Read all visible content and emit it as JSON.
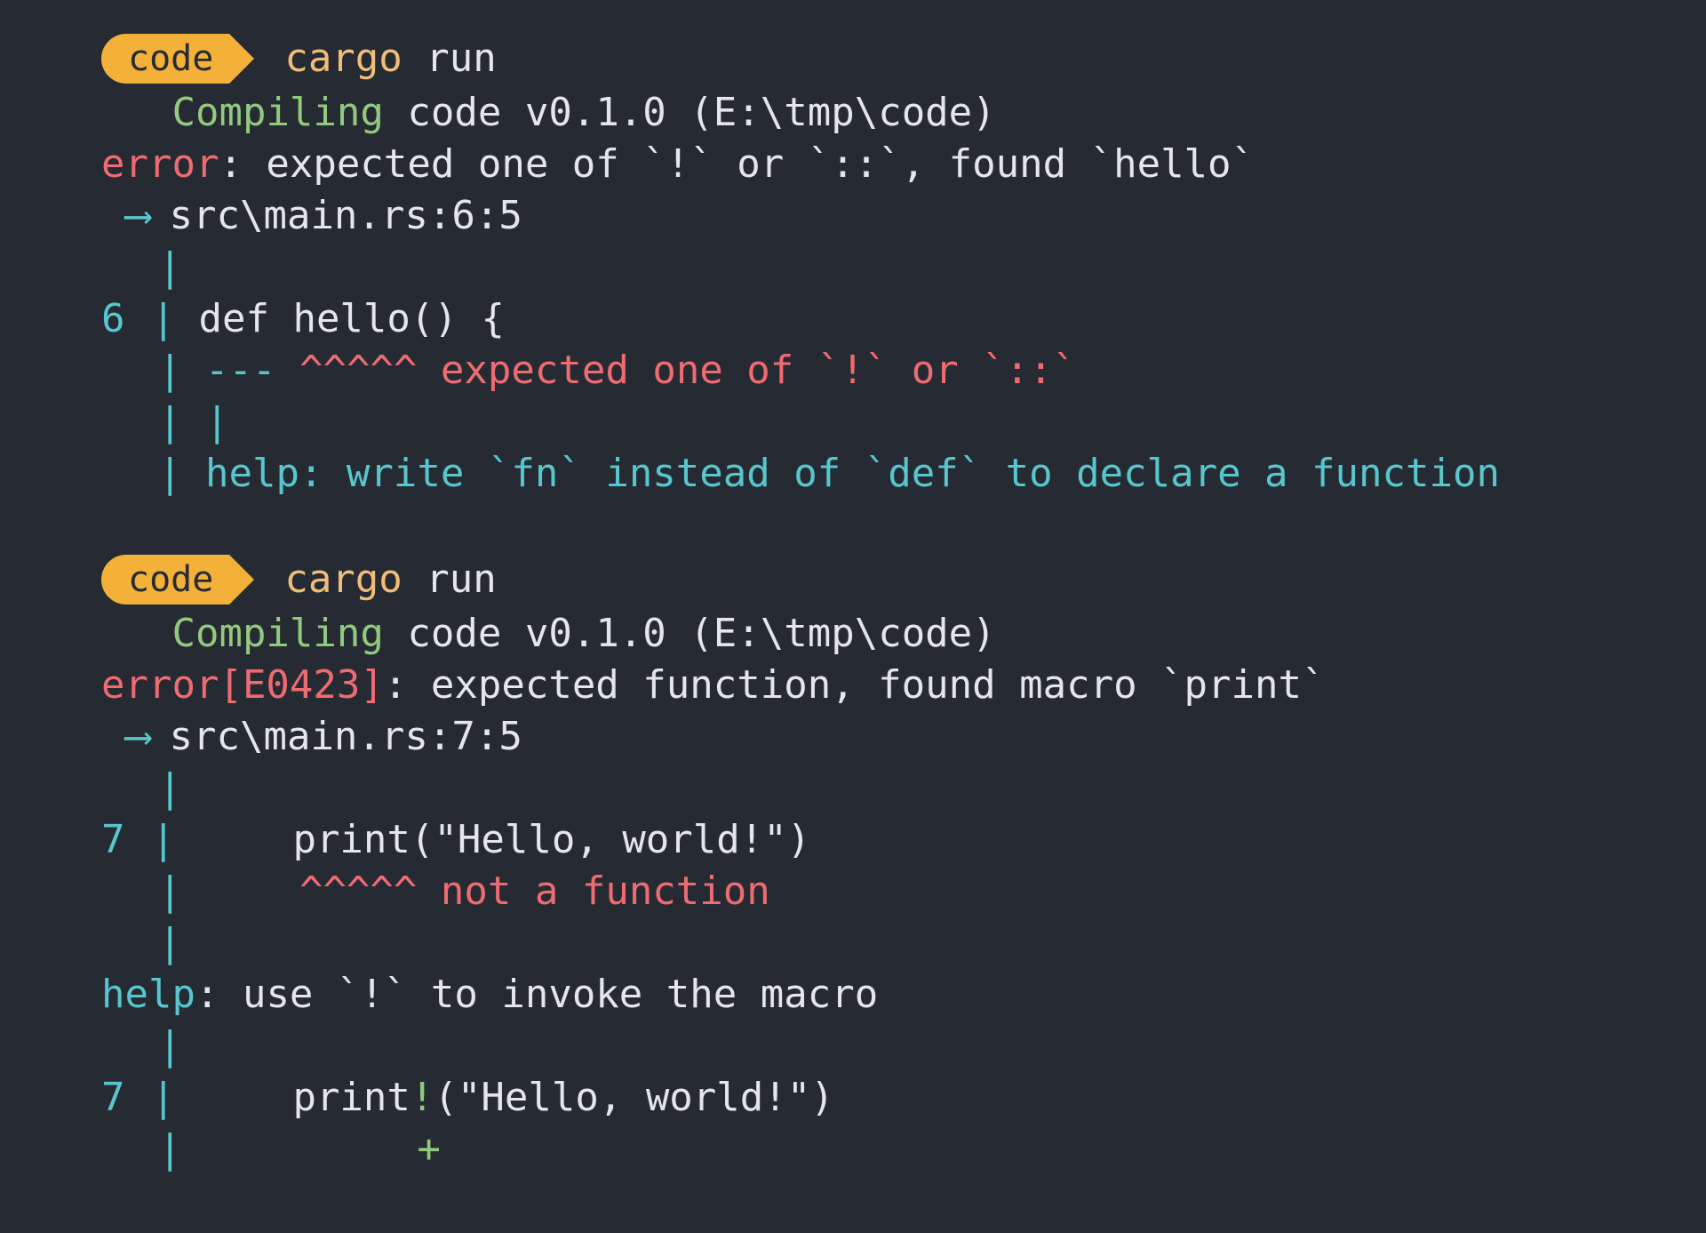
{
  "terminal": {
    "background": "#262b33",
    "foreground": "#e4e6eb",
    "accent_badge_bg": "#f4b13a",
    "accent_badge_fg": "#262b33",
    "error_color": "#ef6b72",
    "success_color": "#93c97e",
    "info_color": "#58c6cd",
    "command_color": "#f0bd7a"
  },
  "blocks": [
    {
      "prompt": {
        "badge_label": "code",
        "command_program": "cargo",
        "command_args": " run"
      },
      "lines": [
        {
          "id": "compiling-1",
          "indent": "   ",
          "status": "Compiling",
          "rest": " code v0.1.0 (E:\\tmp\\code)"
        },
        {
          "id": "error-header-1",
          "severity": "error",
          "code": "",
          "message": ": expected one of `!` or `::`, found `hello`"
        },
        {
          "id": "location-1",
          "arrow": "⟶",
          "path": "src\\main.rs:6:5"
        },
        {
          "id": "gutter-blank-1",
          "gutter": "|"
        },
        {
          "id": "code-line-6",
          "lineno": "6",
          "gutter": "|",
          "code": " def hello() {"
        },
        {
          "id": "annotation-1",
          "gutter": "|",
          "dashes": " ---",
          "carets": " ^^^^^",
          "note": " expected one of `!` or `::`"
        },
        {
          "id": "gutter-bar-1",
          "gutter": "|",
          "inner": " |"
        },
        {
          "id": "help-1",
          "gutter": "|",
          "help_text": " help: write `fn` instead of `def` to declare a function"
        }
      ]
    },
    {
      "prompt": {
        "badge_label": "code",
        "command_program": "cargo",
        "command_args": " run"
      },
      "lines": [
        {
          "id": "compiling-2",
          "indent": "   ",
          "status": "Compiling",
          "rest": " code v0.1.0 (E:\\tmp\\code)"
        },
        {
          "id": "error-header-2",
          "severity": "error",
          "code": "[E0423]",
          "message": ": expected function, found macro `print`"
        },
        {
          "id": "location-2",
          "arrow": "⟶",
          "path": "src\\main.rs:7:5"
        },
        {
          "id": "gutter-blank-2",
          "gutter": "|"
        },
        {
          "id": "code-line-7a",
          "lineno": "7",
          "gutter": "|",
          "code": "     print(\"Hello, world!\")"
        },
        {
          "id": "annotation-2",
          "gutter": "|",
          "carets": "     ^^^^^",
          "note": " not a function"
        },
        {
          "id": "gutter-blank-3",
          "gutter": "|"
        },
        {
          "id": "help-2",
          "help_label": "help",
          "help_rest": ": use `!` to invoke the macro"
        },
        {
          "id": "gutter-blank-4",
          "gutter": "|"
        },
        {
          "id": "code-line-7b",
          "lineno": "7",
          "gutter": "|",
          "code_before": "     print",
          "code_bang": "!",
          "code_after": "(\"Hello, world!\")"
        },
        {
          "id": "suggestion-plus",
          "gutter": "|",
          "plus_indent": "          ",
          "plus": "+"
        }
      ]
    }
  ]
}
